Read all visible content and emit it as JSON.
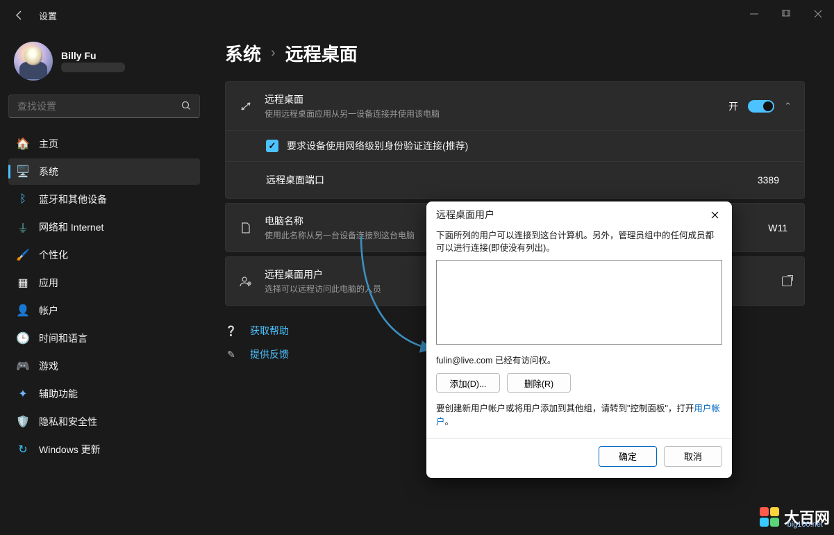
{
  "window": {
    "title": "设置"
  },
  "user": {
    "name": "Billy Fu",
    "email": ""
  },
  "search": {
    "placeholder": "查找设置"
  },
  "nav": {
    "items": [
      {
        "label": "主页"
      },
      {
        "label": "系统"
      },
      {
        "label": "蓝牙和其他设备"
      },
      {
        "label": "网络和 Internet"
      },
      {
        "label": "个性化"
      },
      {
        "label": "应用"
      },
      {
        "label": "帐户"
      },
      {
        "label": "时间和语言"
      },
      {
        "label": "游戏"
      },
      {
        "label": "辅助功能"
      },
      {
        "label": "隐私和安全性"
      },
      {
        "label": "Windows 更新"
      }
    ]
  },
  "breadcrumb": {
    "parent": "系统",
    "sub": "远程桌面"
  },
  "remote": {
    "title": "远程桌面",
    "desc": "使用远程桌面应用从另一设备连接并使用该电脑",
    "toggle_label": "开",
    "nla_label": "要求设备使用网络级别身份验证连接(推荐)",
    "port_label": "远程桌面端口",
    "port_value": "3389",
    "pcname_title": "电脑名称",
    "pcname_desc": "使用此名称从另一台设备连接到这台电脑",
    "pcname_value": "W11",
    "users_title": "远程桌面用户",
    "users_desc": "选择可以远程访问此电脑的人员"
  },
  "help": {
    "get_help": "获取帮助",
    "feedback": "提供反馈"
  },
  "dialog": {
    "title": "远程桌面用户",
    "desc": "下面所列的用户可以连接到这台计算机。另外，管理员组中的任何成员都可以进行连接(即使没有列出)。",
    "access_note": "fulin@live.com 已经有访问权。",
    "add_btn": "添加(D)...",
    "remove_btn": "删除(R)",
    "cp_note_prefix": "要创建新用户帐户或将用户添加到其他组，请转到\"控制面板\"，打开",
    "cp_link": "用户帐户",
    "cp_note_suffix": "。",
    "ok": "确定",
    "cancel": "取消"
  },
  "watermark": {
    "text": "大百网",
    "sub": "big100.net"
  }
}
